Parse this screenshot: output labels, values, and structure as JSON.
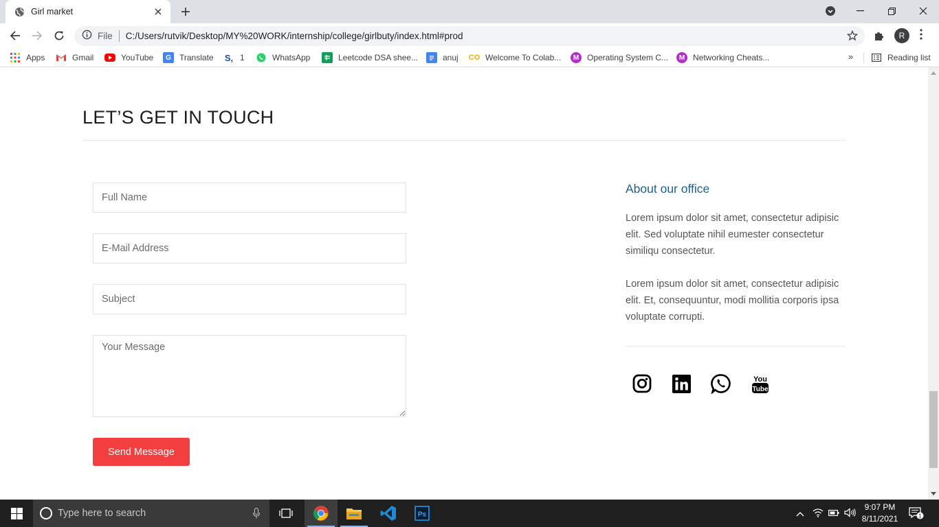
{
  "browser": {
    "tab_title": "Girl market",
    "omnibox_scheme": "File",
    "url": "C:/Users/rutvik/Desktop/MY%20WORK/internship/college/girlbuty/index.html#prod",
    "profile_initial": "R",
    "bookmarks": [
      {
        "label": "Apps",
        "icon": "apps-grid-icon"
      },
      {
        "label": "Gmail",
        "icon": "gmail-icon"
      },
      {
        "label": "YouTube",
        "icon": "youtube-icon"
      },
      {
        "label": "Translate",
        "icon": "translate-icon"
      },
      {
        "label": "1",
        "icon": "s-logo-icon"
      },
      {
        "label": "WhatsApp",
        "icon": "whatsapp-icon"
      },
      {
        "label": "Leetcode DSA shee...",
        "icon": "sheets-icon"
      },
      {
        "label": "anuj",
        "icon": "docs-icon"
      },
      {
        "label": "Welcome To Colab...",
        "icon": "colab-icon"
      },
      {
        "label": "Operating System C...",
        "icon": "m-badge-icon"
      },
      {
        "label": "Networking Cheats...",
        "icon": "m-badge-icon"
      }
    ],
    "more_bookmarks": "»",
    "reading_list": "Reading list"
  },
  "page": {
    "section_title": "LET’S GET IN TOUCH",
    "form": {
      "name_placeholder": "Full Name",
      "email_placeholder": "E-Mail Address",
      "subject_placeholder": "Subject",
      "message_placeholder": "Your Message",
      "send_label": "Send Message"
    },
    "office": {
      "title": "About our office",
      "paragraph_1": "Lorem ipsum dolor sit amet, consectetur adipisic elit. Sed voluptate nihil eumester consectetur similiqu consectetur.",
      "paragraph_2": "Lorem ipsum dolor sit amet, consectetur adipisic elit. Et, consequuntur, modi mollitia corporis ipsa voluptate corrupti."
    },
    "social": [
      "instagram-icon",
      "linkedin-icon",
      "whatsapp-icon",
      "youtube-icon"
    ]
  },
  "colors": {
    "accent_button": "#f33f3f",
    "office_title": "#1f5f8e"
  },
  "taskbar": {
    "search_placeholder": "Type here to search",
    "time": "9:07 PM",
    "date": "8/11/2021",
    "notification_count": "1"
  }
}
